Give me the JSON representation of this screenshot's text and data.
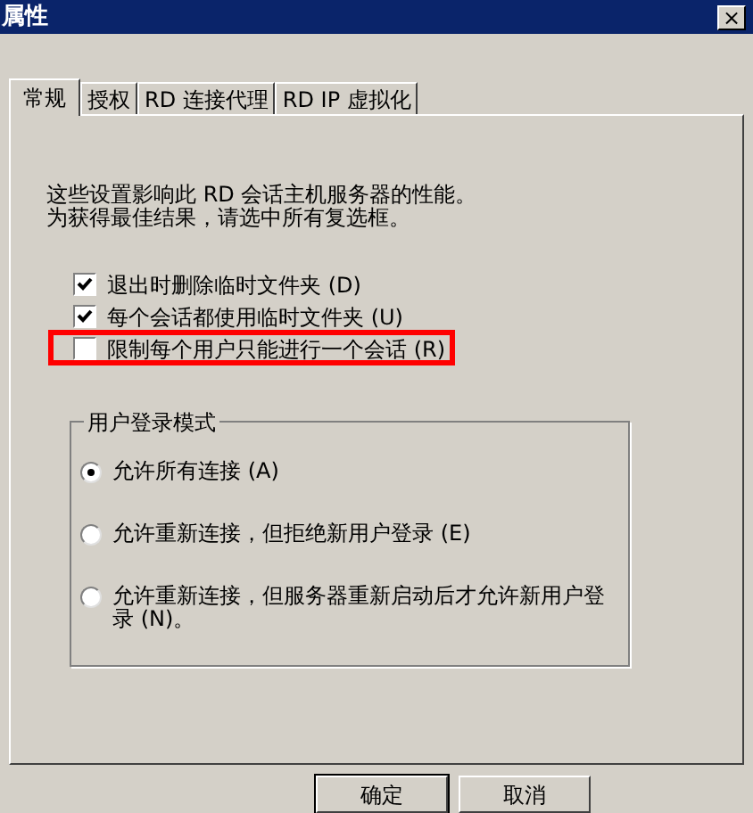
{
  "window": {
    "title": "属性",
    "close": "×"
  },
  "tabs": [
    {
      "label": "常规",
      "selected": true
    },
    {
      "label": "授权",
      "selected": false
    },
    {
      "label": "RD 连接代理",
      "selected": false
    },
    {
      "label": "RD IP 虚拟化",
      "selected": false
    }
  ],
  "description": [
    "这些设置影响此 RD 会话主机服务器的性能。",
    "为获得最佳结果，请选中所有复选框。"
  ],
  "checkboxes": [
    {
      "label": "退出时删除临时文件夹 (D)",
      "checked": true,
      "highlighted": false
    },
    {
      "label": "每个会话都使用临时文件夹 (U)",
      "checked": true,
      "highlighted": false
    },
    {
      "label": "限制每个用户只能进行一个会话 (R)",
      "checked": false,
      "highlighted": true
    }
  ],
  "logon_mode": {
    "title": "用户登录模式",
    "options": [
      {
        "label": "允许所有连接 (A)",
        "selected": true
      },
      {
        "label": "允许重新连接，但拒绝新用户登录 (E)",
        "selected": false
      },
      {
        "label": "允许重新连接，但服务器重新启动后才允许新用户登录 (N)。",
        "selected": false
      }
    ]
  },
  "buttons": [
    {
      "label": "确定",
      "default": true
    },
    {
      "label": "取消",
      "default": false
    }
  ]
}
